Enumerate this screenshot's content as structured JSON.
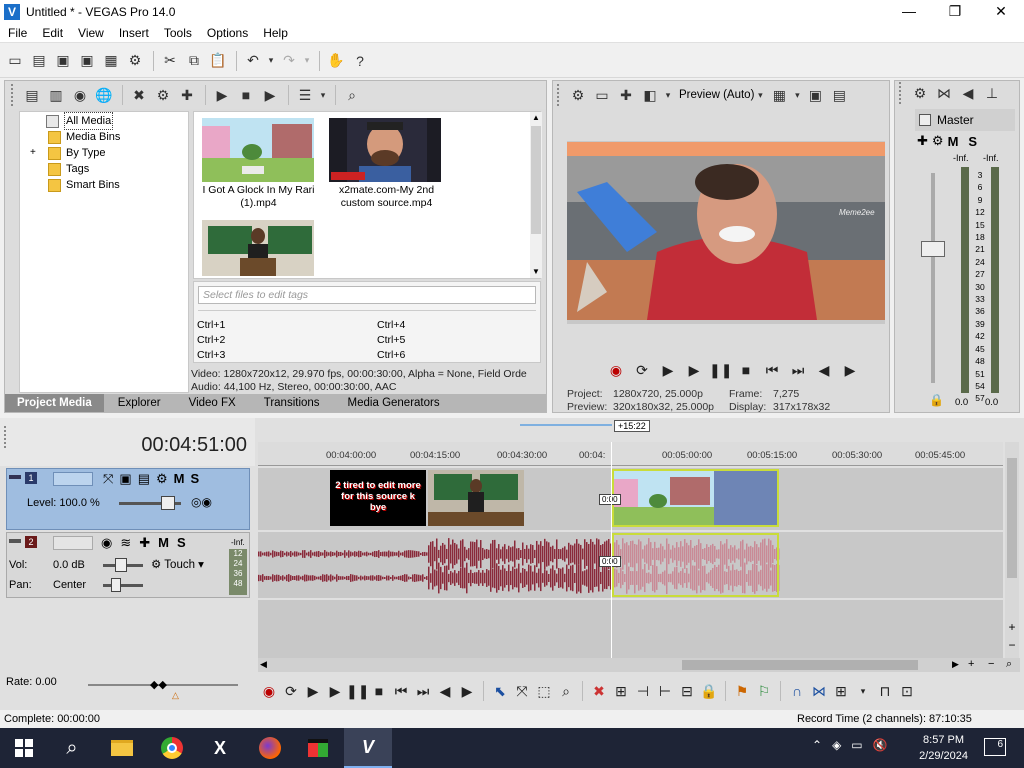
{
  "window": {
    "title": "Untitled * - VEGAS Pro 14.0",
    "minimize": "—",
    "maximize": "❐",
    "close": "✕"
  },
  "menu": [
    "File",
    "Edit",
    "View",
    "Insert",
    "Tools",
    "Options",
    "Help"
  ],
  "media": {
    "tree": [
      "All Media",
      "Media Bins",
      "By Type",
      "Tags",
      "Smart Bins"
    ],
    "expander": "+",
    "files": [
      {
        "name": "I Got A Glock In My Rari (1).mp4",
        "line1": "I Got A Glock In My Rari",
        "line2": "(1).mp4"
      },
      {
        "name": "x2mate.com-My 2nd custom source.mp4",
        "line1": "x2mate.com-My 2nd",
        "line2": "custom source.mp4"
      },
      {
        "name": "",
        "line1": "",
        "line2": ""
      }
    ],
    "tags_placeholder": "Select files to edit tags",
    "shortcuts": [
      "Ctrl+1",
      "Ctrl+2",
      "Ctrl+3",
      "Ctrl+4",
      "Ctrl+5",
      "Ctrl+6"
    ],
    "info_video": "Video: 1280x720x12, 29.970 fps, 00:00:30:00, Alpha = None, Field Orde",
    "info_audio": "Audio: 44,100 Hz, Stereo, 00:00:30:00, AAC",
    "tabs": [
      "Project Media",
      "Explorer",
      "Video FX",
      "Transitions",
      "Media Generators"
    ]
  },
  "preview": {
    "mode": "Preview (Auto)",
    "project_label": "Project:",
    "project_value": "1280x720, 25.000p",
    "frame_label": "Frame:",
    "frame_value": "7,275",
    "preview_label": "Preview:",
    "preview_value": "320x180x32, 25.000p",
    "display_label": "Display:",
    "display_value": "317x178x32",
    "watermark": "Meme2ee"
  },
  "master": {
    "title": "Master",
    "m": "M",
    "s": "S",
    "left_inf": "-Inf.",
    "right_inf": "-Inf.",
    "scale": [
      "3",
      "6",
      "9",
      "12",
      "15",
      "18",
      "21",
      "24",
      "27",
      "30",
      "33",
      "36",
      "39",
      "42",
      "45",
      "48",
      "51",
      "54",
      "57"
    ],
    "bottom_left": "0.0",
    "bottom_right": "0.0"
  },
  "timeline": {
    "timecode": "00:04:51:00",
    "cursor_flag": "+15:22",
    "ruler": [
      "00:04:00:00",
      "00:04:15:00",
      "00:04:30:00",
      "00:04:",
      "00:05:00:00",
      "00:05:15:00",
      "00:05:30:00",
      "00:05:45:00"
    ],
    "track1": {
      "number": "1",
      "m": "M",
      "s": "S",
      "level": "Level: 100.0 %"
    },
    "track2": {
      "number": "2",
      "m": "M",
      "s": "S",
      "vol": "Vol:",
      "vol_value": "0.0 dB",
      "pan": "Pan:",
      "pan_value": "Center",
      "touch": "Touch",
      "meter": [
        "12",
        "24",
        "36",
        "48"
      ],
      "meter_top": "-Inf."
    },
    "clip_text": "2 tired to edit more for this source k bye",
    "fade1": "0:00",
    "fade2": "0:00",
    "rate": "Rate: 0.00"
  },
  "status": {
    "complete": "Complete: 00:00:00",
    "record": "Record Time (2 channels): 87:10:35"
  },
  "taskbar": {
    "time": "8:57 PM",
    "date": "2/29/2024",
    "notifications": "6",
    "search_icon": "search-icon"
  }
}
